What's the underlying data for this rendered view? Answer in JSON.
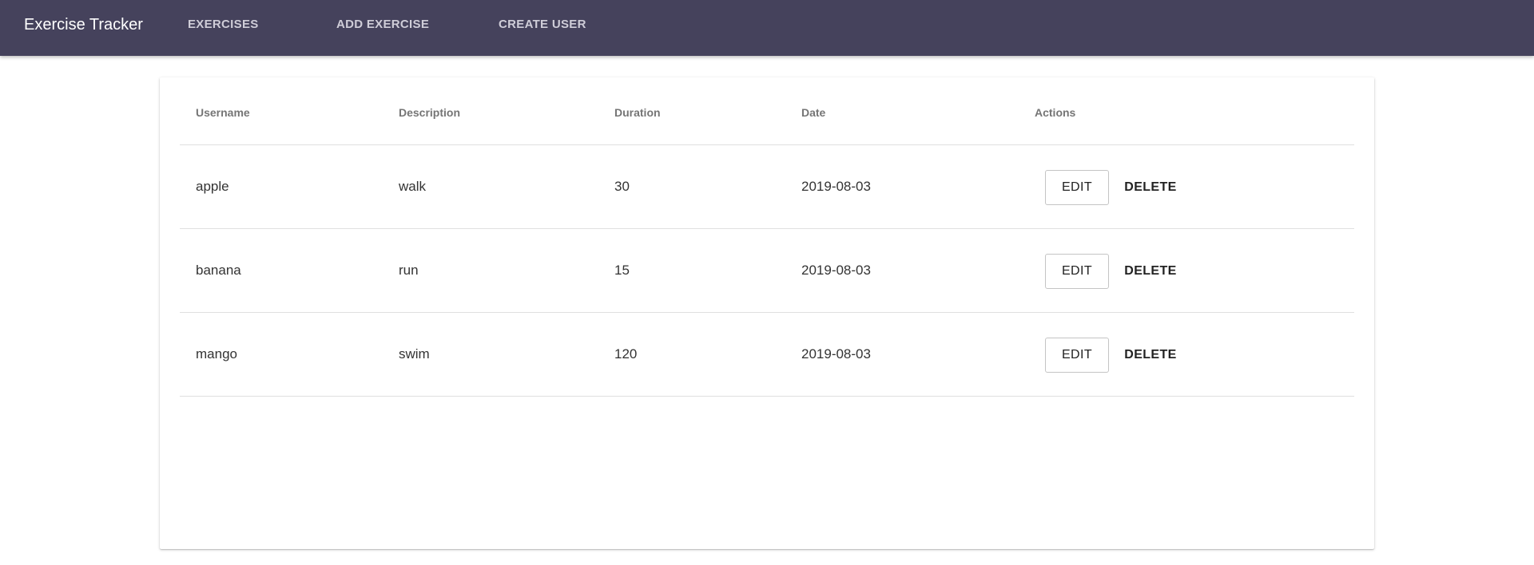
{
  "appbar": {
    "title": "Exercise Tracker",
    "nav": [
      {
        "label": "EXERCISES"
      },
      {
        "label": "ADD EXERCISE"
      },
      {
        "label": "CREATE USER"
      }
    ]
  },
  "table": {
    "columns": [
      "Username",
      "Description",
      "Duration",
      "Date",
      "Actions"
    ],
    "rows": [
      {
        "username": "apple",
        "description": "walk",
        "duration": "30",
        "date": "2019-08-03"
      },
      {
        "username": "banana",
        "description": "run",
        "duration": "15",
        "date": "2019-08-03"
      },
      {
        "username": "mango",
        "description": "swim",
        "duration": "120",
        "date": "2019-08-03"
      }
    ],
    "edit_label": "EDIT",
    "delete_label": "DELETE"
  },
  "colors": {
    "appbar": "#45425c",
    "nav_text": "#cfcdd8",
    "brand_text": "#ffffff"
  }
}
